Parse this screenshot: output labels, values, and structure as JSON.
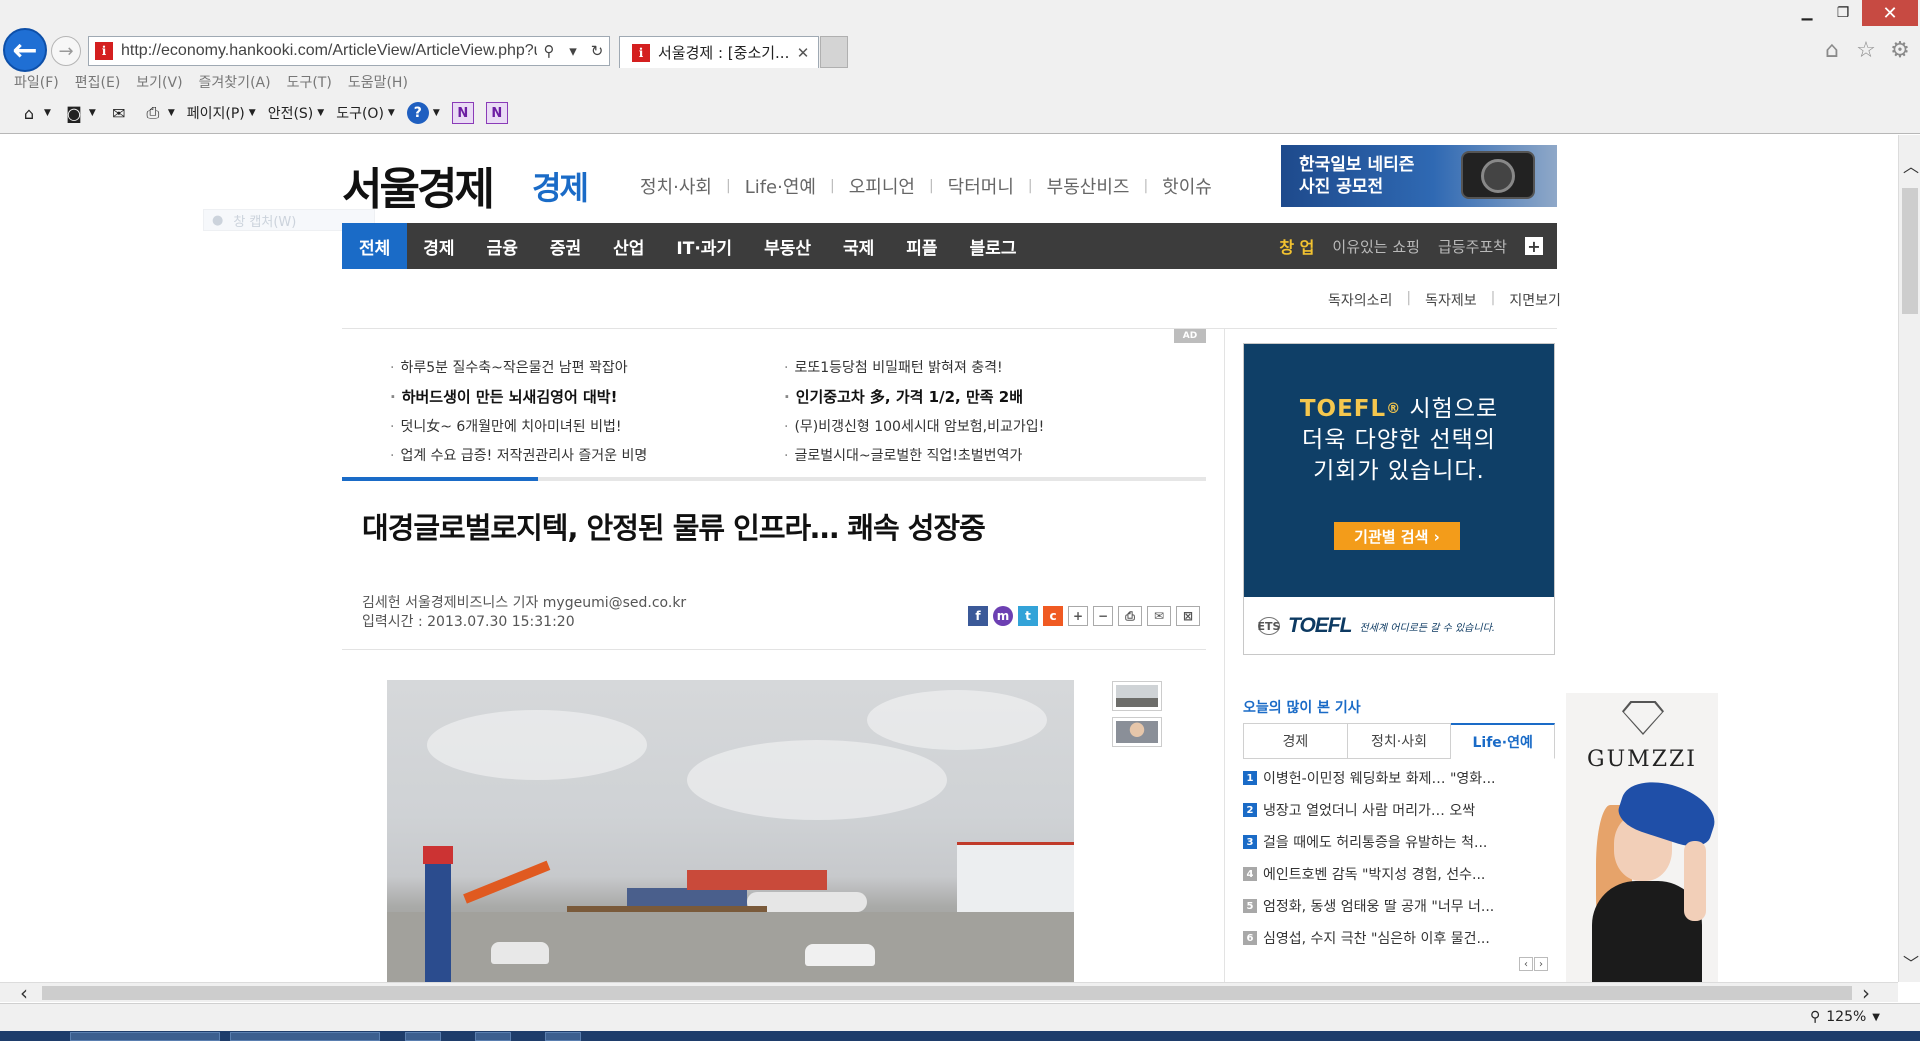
{
  "browser": {
    "url": "http://economy.hankooki.com/ArticleView/ArticleView.php?u",
    "tab_title": "서울경제 : [중소기...",
    "menu": [
      "파일(F)",
      "편집(E)",
      "보기(V)",
      "즐겨찾기(A)",
      "도구(T)",
      "도움말(H)"
    ],
    "commands": {
      "page": "페이지(P)",
      "safety": "안전(S)",
      "tools": "도구(O)"
    },
    "zoom": "125%"
  },
  "site": {
    "logo": "서울경제",
    "logo_sub": "경제",
    "top_links": [
      "정치·사회",
      "Life·연예",
      "오피니언",
      "닥터머니",
      "부동산비즈",
      "핫이슈"
    ],
    "banner_photo": {
      "line1": "한국일보 네티즌",
      "line2": "사진 공모전"
    },
    "capture_ghost": "창 캡처(W)",
    "gnb": [
      "전체",
      "경제",
      "금융",
      "증권",
      "산업",
      "IT·과기",
      "부동산",
      "국제",
      "피플",
      "블로그"
    ],
    "gnb_right": {
      "highlight": "창 업",
      "shopping": "이유있는 쇼핑",
      "stocks": "급등주포착"
    },
    "util_links": [
      "독자의소리",
      "독자제보",
      "지면보기"
    ]
  },
  "ad_links": {
    "badge": "AD",
    "left": [
      {
        "text": "하루5분 질수축~작은물건 남편 꽉잡아",
        "bold": false
      },
      {
        "text": "하버드생이 만든 뇌새김영어 대박!",
        "bold": true
      },
      {
        "text": "덧니女~ 6개월만에 치아미녀된 비법!",
        "bold": false
      },
      {
        "text": "업계 수요 급증! 저작권관리사 즐거운 비명",
        "bold": false
      }
    ],
    "right": [
      {
        "text": "로또1등당첨 비밀패턴 밝혀져 충격!",
        "bold": false
      },
      {
        "text": "인기중고차 多, 가격 1/2, 만족 2배",
        "bold": true
      },
      {
        "text": "(무)비갱신형 100세시대 암보험,비교가입!",
        "bold": false
      },
      {
        "text": "글로벌시대~글로벌한 직업!초벌번역가",
        "bold": false
      }
    ]
  },
  "article": {
    "headline": "대경글로벌로지텍, 안정된 물류 인프라… 쾌속 성장중",
    "byline": "김세헌 서울경제비즈니스 기자 mygeumi@sed.co.kr",
    "date": "입력시간 : 2013.07.30 15:31:20",
    "share": {
      "facebook": "f",
      "me2day": "m",
      "twitter": "t",
      "cyworld": "c",
      "font_plus": "+",
      "font_minus": "−",
      "print": "⎙",
      "email": "✉",
      "scrap": "⊠"
    }
  },
  "toefl_ad": {
    "prefix": "TOEFL",
    "reg": "®",
    "line1": " 시험으로",
    "line2": "더욱 다양한 선택의",
    "line3": "기회가 있습니다.",
    "button": "기관별 검색 ›",
    "ets": "ETS",
    "brand": "TOEFL",
    "tagline": "전세계 어디로든 갈 수 있습니다."
  },
  "popular": {
    "title": "오늘의 많이 본 기사",
    "tabs": [
      "경제",
      "정치·사회",
      "Life·연예"
    ],
    "active_tab": "Life·연예",
    "items": [
      {
        "rank": "1",
        "text": "이병헌-이민정 웨딩화보 화제… \"영화..."
      },
      {
        "rank": "2",
        "text": "냉장고 열었더니 사람 머리가… 오싹"
      },
      {
        "rank": "3",
        "text": "걸을 때에도 허리통증을 유발하는 척..."
      },
      {
        "rank": "4",
        "text": "에인트호벤 감독 \"박지성 경험, 선수..."
      },
      {
        "rank": "5",
        "text": "엄정화, 동생 엄태웅 딸 공개 \"너무 너..."
      },
      {
        "rank": "6",
        "text": "심영섭, 수지 극찬 \"심은하 이후 물건..."
      }
    ],
    "pager": {
      "prev": "‹",
      "next": "›"
    }
  },
  "gumzzi_ad": {
    "brand": "GUMZZI"
  },
  "colors": {
    "accent": "#1a6bc7",
    "gnb_bg": "#3c3c3c",
    "toefl_bg": "#0f3f67",
    "toefl_button": "#f39c1a",
    "gnb_highlight": "#f2c230"
  }
}
